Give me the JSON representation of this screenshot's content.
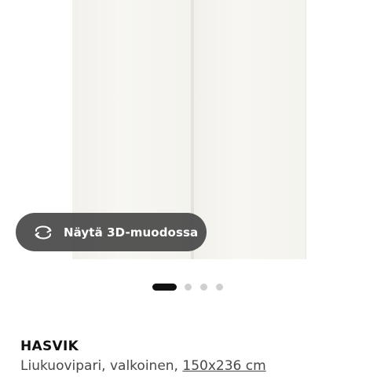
{
  "gallery": {
    "view_3d_label": "Näytä 3D-muodossa",
    "view_3d_icon": "rotate-360-icon",
    "dots_count": 4,
    "active_index": 0
  },
  "product": {
    "name": "HASVIK",
    "description": "Liukuovipari, valkoinen,",
    "size": "150x236 cm"
  },
  "colors": {
    "pill_bg": "#484848",
    "active_dot": "#111111",
    "inactive_dot": "#cfcfcf"
  }
}
